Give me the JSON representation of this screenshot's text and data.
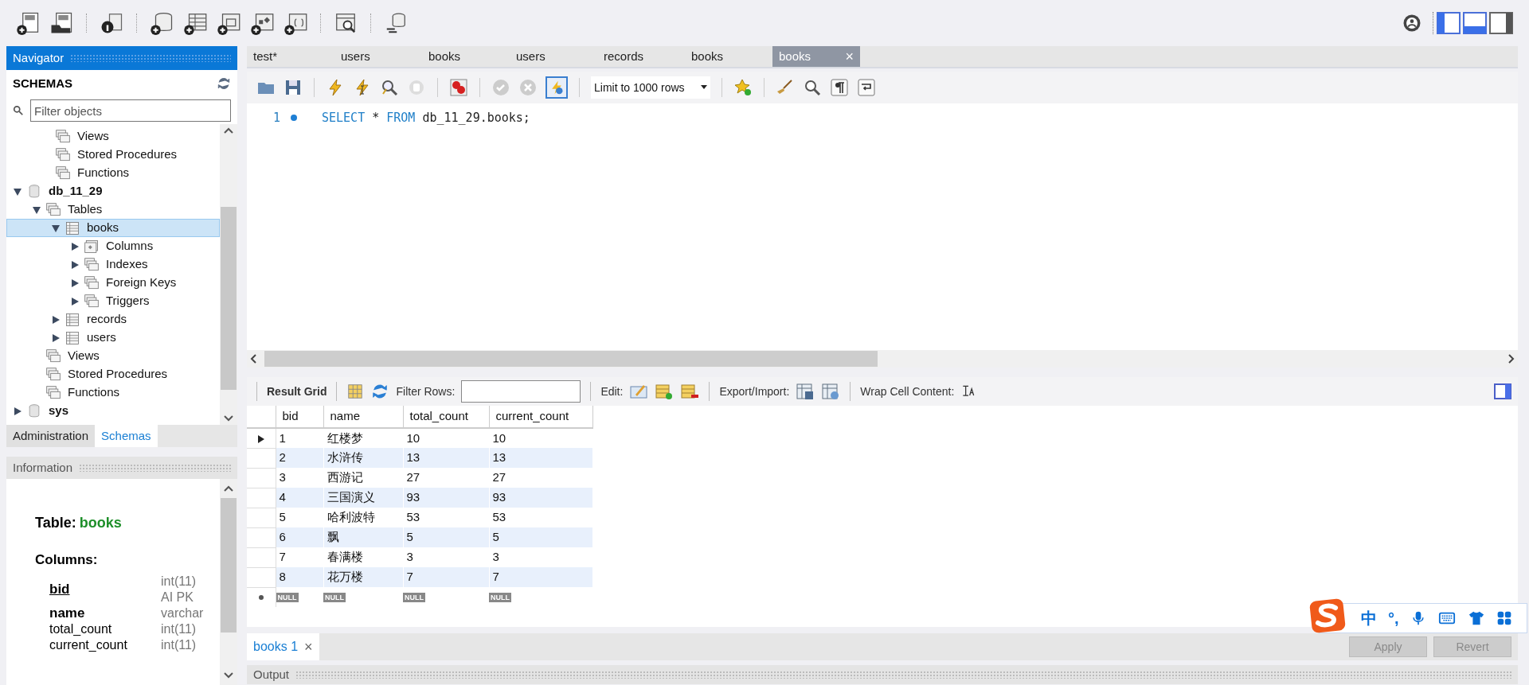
{
  "navigator": {
    "title": "Navigator",
    "section": "SCHEMAS",
    "filter": {
      "placeholder": "Filter objects"
    },
    "tree_top": [
      {
        "label": "Views",
        "kind": "folder",
        "selected": false
      },
      {
        "label": "Stored Procedures",
        "kind": "folder",
        "selected": false
      },
      {
        "label": "Functions",
        "kind": "folder",
        "selected": false
      }
    ],
    "tree": [
      {
        "label": "db_11_29",
        "kind": "schema",
        "expanded": true,
        "selected": false,
        "children": [
          {
            "label": "Tables",
            "kind": "folder",
            "expanded": true,
            "selected": false,
            "children": [
              {
                "label": "books",
                "kind": "table",
                "expanded": true,
                "selected": true,
                "children": [
                  {
                    "label": "Columns",
                    "kind": "columns",
                    "expanded": false,
                    "selected": false
                  },
                  {
                    "label": "Indexes",
                    "kind": "folder",
                    "expanded": false,
                    "selected": false
                  },
                  {
                    "label": "Foreign Keys",
                    "kind": "folder",
                    "expanded": false,
                    "selected": false
                  },
                  {
                    "label": "Triggers",
                    "kind": "folder",
                    "expanded": false,
                    "selected": false
                  }
                ]
              },
              {
                "label": "records",
                "kind": "table",
                "expanded": false,
                "selected": false
              },
              {
                "label": "users",
                "kind": "table",
                "expanded": false,
                "selected": false
              }
            ]
          },
          {
            "label": "Views",
            "kind": "folder",
            "selected": false
          },
          {
            "label": "Stored Procedures",
            "kind": "folder",
            "selected": false
          },
          {
            "label": "Functions",
            "kind": "folder",
            "selected": false
          }
        ]
      },
      {
        "label": "sys",
        "kind": "schema",
        "expanded": false,
        "selected": false
      }
    ],
    "tabs": [
      {
        "label": "Administration",
        "selected": false
      },
      {
        "label": "Schemas",
        "selected": true
      }
    ]
  },
  "information": {
    "title": "Information",
    "table_label": "Table:",
    "table_name": "books",
    "columns_label": "Columns:",
    "columns": [
      {
        "name": "bid",
        "kind": "primary",
        "type": "int(11)",
        "flags": "AI PK"
      },
      {
        "name": "name",
        "kind": "required",
        "type": "varchar"
      },
      {
        "name": "total_count",
        "kind": "plain",
        "type": "int(11)"
      },
      {
        "name": "current_count",
        "kind": "plain",
        "type": "int(11)"
      }
    ]
  },
  "editor_tabs": [
    {
      "label": "test*",
      "selected": false
    },
    {
      "label": "users",
      "selected": false
    },
    {
      "label": "books",
      "selected": false
    },
    {
      "label": "users",
      "selected": false
    },
    {
      "label": "records",
      "selected": false
    },
    {
      "label": "books",
      "selected": false
    },
    {
      "label": "books",
      "selected": true,
      "close": "×"
    }
  ],
  "editor_toolbar": {
    "limit": "Limit to 1000 rows"
  },
  "editor": {
    "lines": [
      {
        "number": "1",
        "tokens": [
          {
            "text": "SELECT",
            "kind": "keyword"
          },
          {
            "text": "*",
            "kind": "plain"
          },
          {
            "text": "FROM",
            "kind": "keyword"
          },
          {
            "text": "db_11_29.books;",
            "kind": "plain"
          }
        ]
      }
    ]
  },
  "results": {
    "toolbar": {
      "result_grid": "Result Grid",
      "filter_label": "Filter Rows:",
      "edit_label": "Edit:",
      "export_label": "Export/Import:",
      "wrap_label": "Wrap Cell Content:"
    },
    "columns": [
      "bid",
      "name",
      "total_count",
      "current_count"
    ],
    "rows": [
      {
        "cells": [
          "1",
          "红楼梦",
          "10",
          "10"
        ],
        "current": true
      },
      {
        "cells": [
          "2",
          "水浒传",
          "13",
          "13"
        ],
        "current": false
      },
      {
        "cells": [
          "3",
          "西游记",
          "27",
          "27"
        ],
        "current": false
      },
      {
        "cells": [
          "4",
          "三国演义",
          "93",
          "93"
        ],
        "current": false
      },
      {
        "cells": [
          "5",
          "哈利波特",
          "53",
          "53"
        ],
        "current": false
      },
      {
        "cells": [
          "6",
          "飘",
          "5",
          "5"
        ],
        "current": false
      },
      {
        "cells": [
          "7",
          "春满楼",
          "3",
          "3"
        ],
        "current": false
      },
      {
        "cells": [
          "8",
          "花万楼",
          "7",
          "7"
        ],
        "current": false
      }
    ],
    "new_row": [
      "NULL",
      "NULL",
      "NULL",
      "NULL"
    ]
  },
  "result_tabs": [
    {
      "label": "books 1",
      "selected": true,
      "close": "×"
    }
  ],
  "buttons": [
    {
      "label": "Apply",
      "disabled": true
    },
    {
      "label": "Revert",
      "disabled": true
    }
  ],
  "output": {
    "title": "Output"
  },
  "ime_bar": {
    "items": [
      "中",
      "°,"
    ]
  }
}
